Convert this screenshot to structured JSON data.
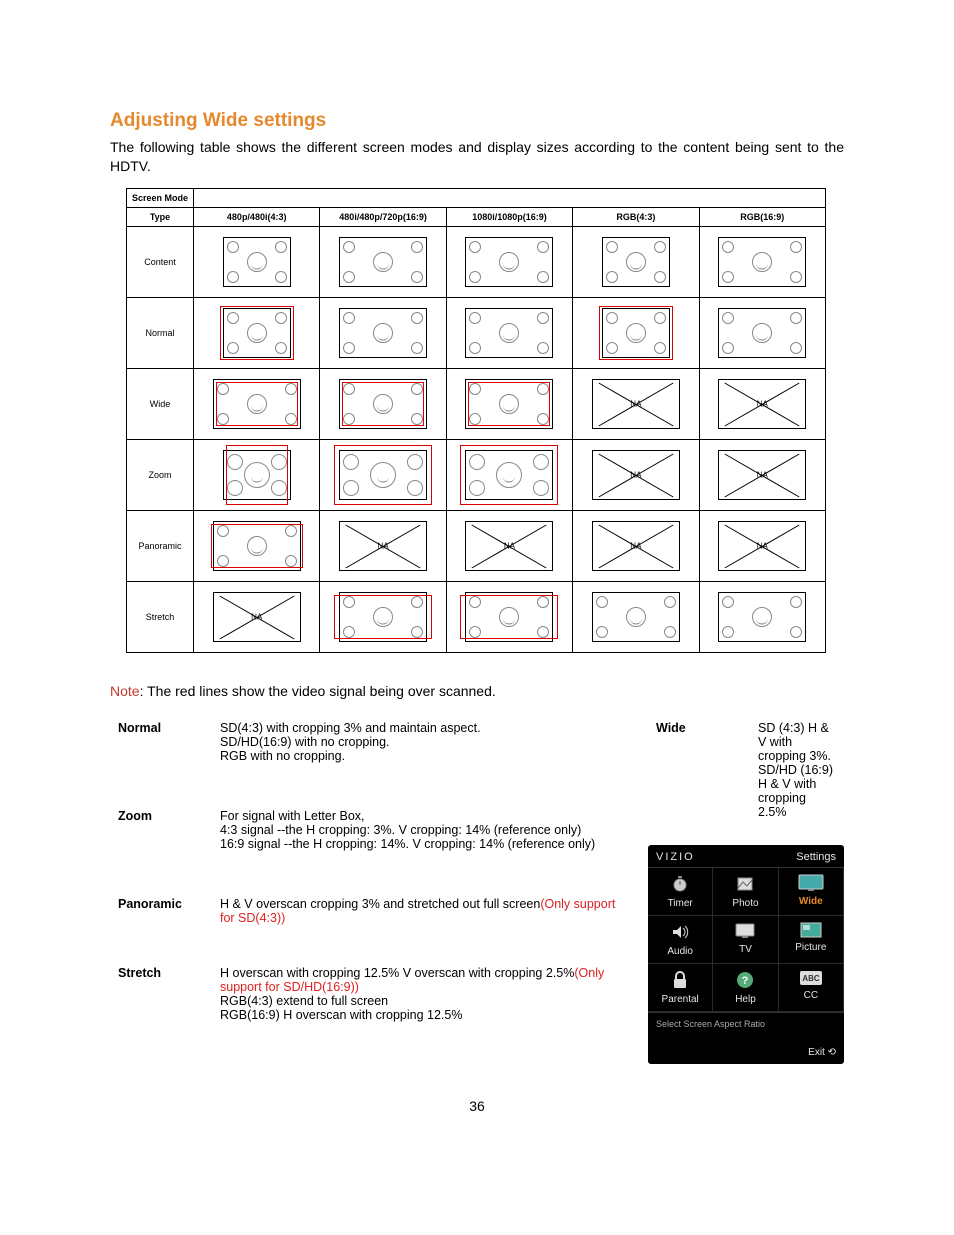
{
  "title": "Adjusting Wide settings",
  "intro": "The following table shows the different screen modes and display sizes according to the content being sent to the HDTV.",
  "table_header_left": "Screen Mode",
  "table_headers": [
    "Type",
    "480p/480i(4:3)",
    "480i/480p/720p(16:9)",
    "1080i/1080p(16:9)",
    "RGB(4:3)",
    "RGB(16:9)"
  ],
  "row_names": [
    "Content",
    "Normal",
    "Wide",
    "Zoom",
    "Panoramic",
    "Stretch"
  ],
  "na_label": "NA",
  "note_word": "Note",
  "note_rest": ": The red lines show the video signal being over scanned.",
  "defs": {
    "normal": {
      "label": "Normal",
      "lines": [
        "SD(4:3) with cropping 3% and maintain aspect.",
        "SD/HD(16:9) with no cropping.",
        "RGB with no cropping."
      ]
    },
    "zoom": {
      "label": "Zoom",
      "lines": [
        "For signal with Letter Box,",
        "4:3 signal --the  H cropping: 3%. V cropping: 14% (reference only)",
        "16:9 signal --the  H cropping: 14%. V cropping: 14% (reference only)"
      ]
    },
    "panoramic": {
      "label": "Panoramic",
      "line1": "H & V overscan cropping 3% and stretched out full screen",
      "red": "(Only support for SD(4:3))"
    },
    "stretch": {
      "label": "Stretch",
      "line1": "H overscan with cropping 12.5% V overscan with cropping 2.5%",
      "red": "(Only support for SD/HD(16:9))",
      "line2": "RGB(4:3) extend to full screen",
      "line3": "RGB(16:9) H overscan with cropping 12.5%"
    }
  },
  "wide": {
    "label": "Wide",
    "lines": [
      "SD (4:3) H & V with cropping 3%.",
      "SD/HD (16:9) H & V with cropping 2.5%"
    ]
  },
  "osd": {
    "brand": "VIZIO",
    "settings": "Settings",
    "icons": [
      {
        "name": "Timer",
        "icon": "timer"
      },
      {
        "name": "Photo",
        "icon": "photo"
      },
      {
        "name": "Wide",
        "icon": "wide",
        "highlight": true
      },
      {
        "name": "Audio",
        "icon": "audio"
      },
      {
        "name": "TV",
        "icon": "tv"
      },
      {
        "name": "Picture",
        "icon": "picture"
      },
      {
        "name": "Parental",
        "icon": "lock"
      },
      {
        "name": "Help",
        "icon": "help"
      },
      {
        "name": "CC",
        "icon": "cc"
      }
    ],
    "help": "Select Screen Aspect Ratio",
    "exit": "Exit"
  },
  "page_num": "36"
}
